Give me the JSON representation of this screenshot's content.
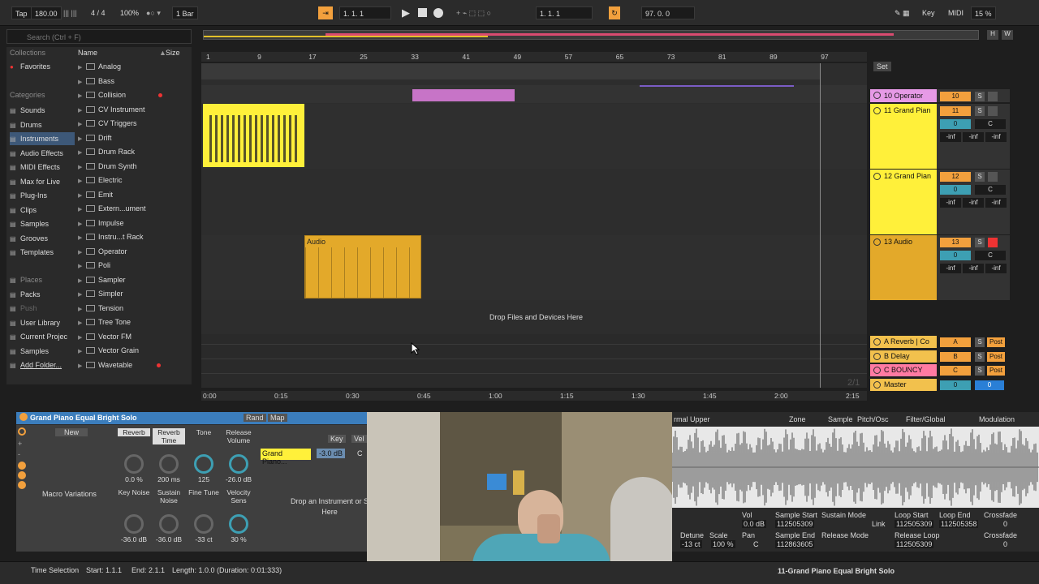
{
  "topbar": {
    "tap": "Tap",
    "tempo": "180.00",
    "signature": "4 / 4",
    "zoom": "100%",
    "quantize": "1 Bar",
    "position": "1.   1.   1",
    "loop_start": "1.   1.   1",
    "loop_len": "97.   0.   0",
    "key": "Key",
    "midi": "MIDI",
    "cpu": "15 %"
  },
  "browser": {
    "search_placeholder": "Search (Ctrl + F)",
    "collections_head": "Collections",
    "favorites": "Favorites",
    "categories_head": "Categories",
    "categories": [
      "Sounds",
      "Drums",
      "Instruments",
      "Audio Effects",
      "MIDI Effects",
      "Max for Live",
      "Plug-Ins",
      "Clips",
      "Samples",
      "Grooves",
      "Templates"
    ],
    "places": [
      "Places",
      "Packs",
      "Push",
      "User Library",
      "Current Projec",
      "Samples",
      "Add Folder..."
    ],
    "col_name": "Name",
    "col_size": "Size",
    "items": [
      "Analog",
      "Bass",
      "Collision",
      "CV Instrument",
      "CV Triggers",
      "Drift",
      "Drum Rack",
      "Drum Synth",
      "Electric",
      "Emit",
      "Extern...ument",
      "Impulse",
      "Instru...t Rack",
      "Operator",
      "Poli",
      "Sampler",
      "Simpler",
      "Tension",
      "Tree Tone",
      "Vector FM",
      "Vector Grain",
      "Wavetable"
    ]
  },
  "ruler": {
    "bars": [
      "1",
      "9",
      "17",
      "25",
      "33",
      "41",
      "49",
      "57",
      "65",
      "73",
      "81",
      "89",
      "97"
    ],
    "times": [
      "0:00",
      "0:15",
      "0:30",
      "0:45",
      "1:00",
      "1:15",
      "1:30",
      "1:45",
      "2:00",
      "2:15"
    ],
    "set_label": "Set"
  },
  "arrangement": {
    "audio_clip_label": "Audio",
    "drop_text": "Drop Files and Devices Here",
    "page_count": "2/1"
  },
  "tracks": [
    {
      "name": "10 Operator",
      "num": "10",
      "color": "#e69ae6"
    },
    {
      "name": "11 Grand Pian",
      "num": "11",
      "color": "#fff03a"
    },
    {
      "name": "12 Grand Pian",
      "num": "12",
      "color": "#fff03a"
    },
    {
      "name": "13 Audio",
      "num": "13",
      "color": "#e3a92a"
    }
  ],
  "returns": [
    {
      "name": "A Reverb | Co",
      "letter": "A"
    },
    {
      "name": "B Delay",
      "letter": "B"
    },
    {
      "name": "C BOUNCY",
      "letter": "C"
    },
    {
      "name": "Master",
      "letter": "0"
    }
  ],
  "mixer": {
    "vol": "0",
    "pan": "C",
    "inf": "-inf",
    "post": "Post",
    "solo": "S"
  },
  "device": {
    "title": "Grand Piano Equal Bright Solo",
    "rand": "Rand",
    "map": "Map",
    "new_label": "New",
    "macro_variations": "Macro Variations",
    "knobs": [
      {
        "label": "Reverb",
        "value": "0.0 %"
      },
      {
        "label": "Reverb Time",
        "value": "200 ms"
      },
      {
        "label": "Tone",
        "value": "125"
      },
      {
        "label": "Release Volume",
        "value": "-26.0 dB"
      },
      {
        "label": "Key Noise",
        "value": "-36.0 dB"
      },
      {
        "label": "Sustain Noise",
        "value": "-36.0 dB"
      },
      {
        "label": "Fine Tune",
        "value": "-33 ct"
      },
      {
        "label": "Velocity Sens",
        "value": "30 %"
      }
    ],
    "chain_name": "Grand Piano...",
    "chain_db": "-3.0 dB",
    "chain_pan": "C",
    "key": "Key",
    "vel": "Vel",
    "drop_instrument": "Drop an Instrument or S Here"
  },
  "sampler": {
    "tabs": [
      "Zone",
      "Sample",
      "Pitch/Osc",
      "Filter/Global",
      "Modulation"
    ],
    "header": "rmal  Upper",
    "vol_label": "Vol",
    "vol": "0.0 dB",
    "sample_start_label": "Sample Start",
    "sample_start": "112505309",
    "sustain_mode": "Sustain Mode",
    "link": "Link",
    "loop_start_label": "Loop Start",
    "loop_start": "112505309",
    "loop_end_label": "Loop End",
    "loop_end": "112505358",
    "crossfade_label": "Crossfade",
    "crossfade": "0",
    "detune_label": "Detune",
    "detune": "-13 ct",
    "scale_label": "Scale",
    "scale": "100 %",
    "pan_label": "Pan",
    "pan": "C",
    "sample_end_label": "Sample End",
    "sample_end": "112863605",
    "release_mode": "Release Mode",
    "release_loop_label": "Release Loop",
    "release_loop": "112505309",
    "crossfade2": "0"
  },
  "status": {
    "selection": "Time Selection",
    "start": "Start: 1.1.1",
    "end": "End: 2.1.1",
    "length": "Length: 1.0.0 (Duration: 0:01:333)",
    "track": "11-Grand Piano Equal Bright Solo"
  }
}
